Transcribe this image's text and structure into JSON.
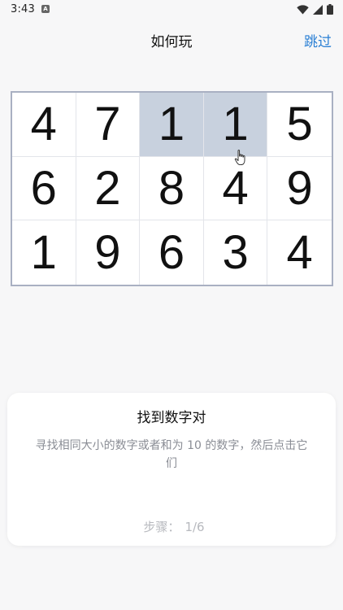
{
  "status_bar": {
    "time": "3:43",
    "notification_icon": "A"
  },
  "header": {
    "title": "如何玩",
    "skip_label": "跳过"
  },
  "grid": {
    "rows": [
      [
        "4",
        "7",
        "1",
        "1",
        "5"
      ],
      [
        "6",
        "2",
        "8",
        "4",
        "9"
      ],
      [
        "1",
        "9",
        "6",
        "3",
        "4"
      ]
    ],
    "selected_color": "#c8d1de"
  },
  "tutorial_card": {
    "title": "找到数字对",
    "description": "寻找相同大小的数字或者和为 10 的数字，然后点击它们",
    "step_label": "步骤：",
    "step_value": "1/6"
  },
  "colors": {
    "accent": "#2a7fd4",
    "grid_border": "#a9b0c2"
  }
}
